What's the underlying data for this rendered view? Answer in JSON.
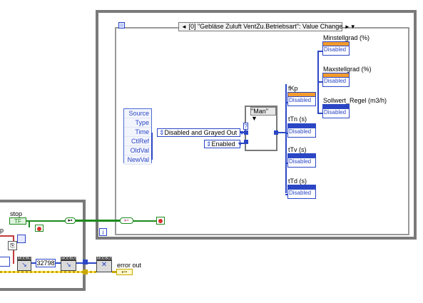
{
  "event_structure": {
    "header": "[0] \"Gebläse Zuluft VentZu.Betriebsart\": Value Change",
    "left_arrow": "◄",
    "right_arrow": "►▼",
    "event_data": [
      "Source",
      "Type",
      "Time",
      "CtlRef",
      "OldVal",
      "NewVal"
    ],
    "iteration_terminal": "i"
  },
  "enums": {
    "disabled_and_grayed_out": "Disabled and Grayed Out",
    "enabled": "Enabled"
  },
  "case_structure": {
    "selector": "\"Man\"",
    "question_terminal": "?"
  },
  "property_nodes": [
    {
      "label": "Minstellgrad (%)",
      "property": "Disabled",
      "color": "#f39b2d"
    },
    {
      "label": "Maxstellgrad (%)",
      "property": "Disabled",
      "color": "#f39b2d"
    },
    {
      "label": "fKp",
      "property": "Disabled",
      "color": "#f39b2d"
    },
    {
      "label": "Sollwert_Regel (m3/h)",
      "property": "Disabled",
      "color": "#2b46c5"
    },
    {
      "label": "tTn (s)",
      "property": "Disabled",
      "color": "#2b46c5"
    },
    {
      "label": "tTv (s)",
      "property": "Disabled",
      "color": "#2b46c5"
    },
    {
      "label": "tTd (s)",
      "property": "Disabled",
      "color": "#2b46c5"
    }
  ],
  "lower": {
    "stop_label": "stop",
    "stop_terminal": "TF",
    "p_label": "p",
    "constant": "32798",
    "modbus_label": "MODBUS",
    "error_out_label": "error out"
  },
  "colors": {
    "frame": "#7a7a7a",
    "blue_wire": "#2b46c5",
    "green_wire": "#1d8a1d",
    "orange": "#f39b2d"
  }
}
